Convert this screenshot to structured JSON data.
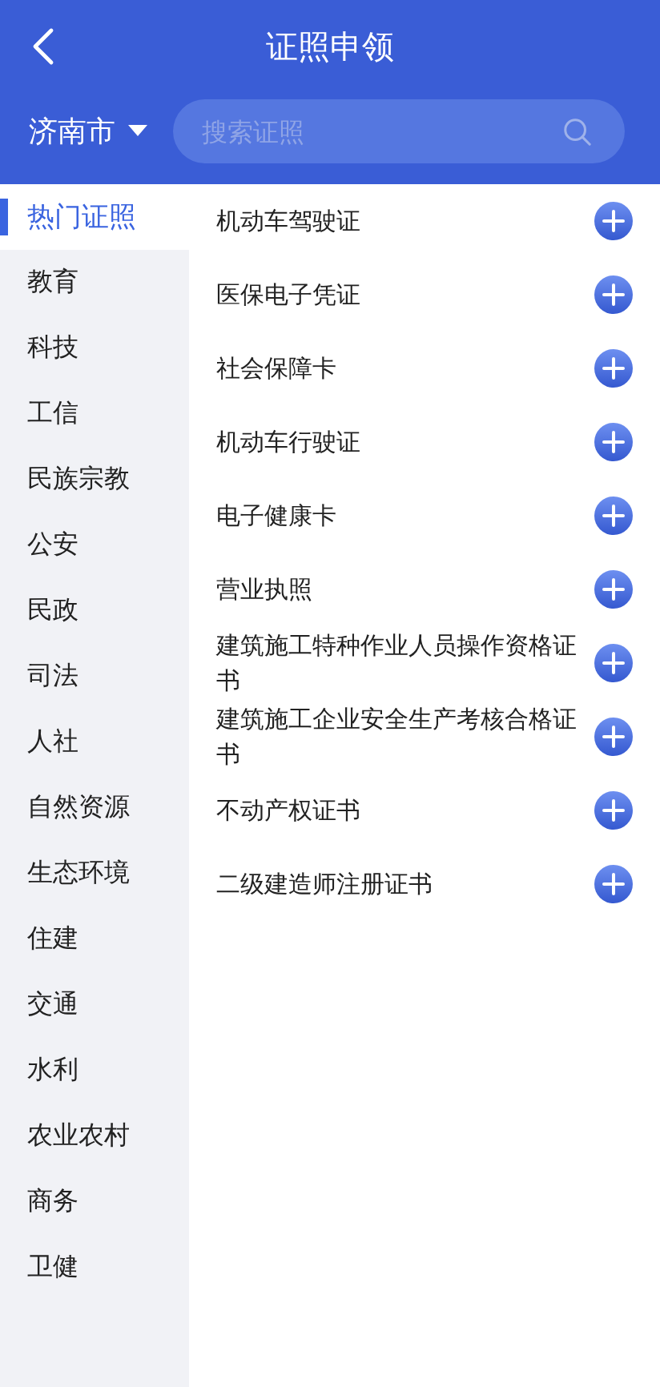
{
  "header": {
    "title": "证照申领",
    "city": "济南市",
    "search": {
      "placeholder": "搜索证照"
    }
  },
  "categories": [
    {
      "label": "热门证照",
      "selected": true
    },
    {
      "label": "教育",
      "selected": false
    },
    {
      "label": "科技",
      "selected": false
    },
    {
      "label": "工信",
      "selected": false
    },
    {
      "label": "民族宗教",
      "selected": false
    },
    {
      "label": "公安",
      "selected": false
    },
    {
      "label": "民政",
      "selected": false
    },
    {
      "label": "司法",
      "selected": false
    },
    {
      "label": "人社",
      "selected": false
    },
    {
      "label": "自然资源",
      "selected": false
    },
    {
      "label": "生态环境",
      "selected": false
    },
    {
      "label": "住建",
      "selected": false
    },
    {
      "label": "交通",
      "selected": false
    },
    {
      "label": "水利",
      "selected": false
    },
    {
      "label": "农业农村",
      "selected": false
    },
    {
      "label": "商务",
      "selected": false
    },
    {
      "label": "卫健",
      "selected": false
    }
  ],
  "licenses": [
    "机动车驾驶证",
    "医保电子凭证",
    "社会保障卡",
    "机动车行驶证",
    "电子健康卡",
    "营业执照",
    "建筑施工特种作业人员操作资格证书",
    "建筑施工企业安全生产考核合格证书",
    "不动产权证书",
    "二级建造师注册证书"
  ]
}
